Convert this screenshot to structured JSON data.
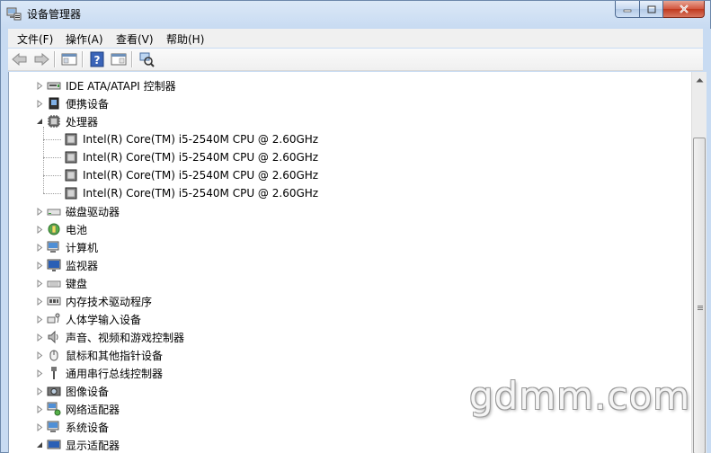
{
  "window": {
    "title": "设备管理器"
  },
  "menu": [
    {
      "label": "文件(F)"
    },
    {
      "label": "操作(A)"
    },
    {
      "label": "查看(V)"
    },
    {
      "label": "帮助(H)"
    }
  ],
  "toolbar": [
    {
      "icon": "back-arrow-icon"
    },
    {
      "icon": "forward-arrow-icon"
    },
    {
      "icon": "show-hide-console-tree-icon"
    },
    {
      "icon": "help-icon"
    },
    {
      "icon": "properties-pane-icon"
    },
    {
      "icon": "scan-hardware-changes-icon"
    }
  ],
  "tree": [
    {
      "label": "IDE ATA/ATAPI 控制器",
      "expanded": false,
      "icon": "ide-controller-icon"
    },
    {
      "label": "便携设备",
      "expanded": false,
      "icon": "portable-device-icon"
    },
    {
      "label": "处理器",
      "expanded": true,
      "icon": "processor-icon",
      "children": [
        {
          "label": "Intel(R) Core(TM) i5-2540M CPU @ 2.60GHz"
        },
        {
          "label": "Intel(R) Core(TM) i5-2540M CPU @ 2.60GHz"
        },
        {
          "label": "Intel(R) Core(TM) i5-2540M CPU @ 2.60GHz"
        },
        {
          "label": "Intel(R) Core(TM) i5-2540M CPU @ 2.60GHz"
        }
      ]
    },
    {
      "label": "磁盘驱动器",
      "expanded": false,
      "icon": "disk-drive-icon"
    },
    {
      "label": "电池",
      "expanded": false,
      "icon": "battery-icon"
    },
    {
      "label": "计算机",
      "expanded": false,
      "icon": "computer-icon"
    },
    {
      "label": "监视器",
      "expanded": false,
      "icon": "monitor-icon"
    },
    {
      "label": "键盘",
      "expanded": false,
      "icon": "keyboard-icon"
    },
    {
      "label": "内存技术驱动程序",
      "expanded": false,
      "icon": "memory-technology-icon"
    },
    {
      "label": "人体学输入设备",
      "expanded": false,
      "icon": "hid-icon"
    },
    {
      "label": "声音、视频和游戏控制器",
      "expanded": false,
      "icon": "sound-icon"
    },
    {
      "label": "鼠标和其他指针设备",
      "expanded": false,
      "icon": "mouse-icon"
    },
    {
      "label": "通用串行总线控制器",
      "expanded": false,
      "icon": "usb-icon"
    },
    {
      "label": "图像设备",
      "expanded": false,
      "icon": "imaging-device-icon"
    },
    {
      "label": "网络适配器",
      "expanded": false,
      "icon": "network-adapter-icon"
    },
    {
      "label": "系统设备",
      "expanded": false,
      "icon": "system-device-icon"
    },
    {
      "label": "显示适配器",
      "expanded": true,
      "icon": "display-adapter-icon"
    }
  ],
  "watermark": "gdmm.com"
}
